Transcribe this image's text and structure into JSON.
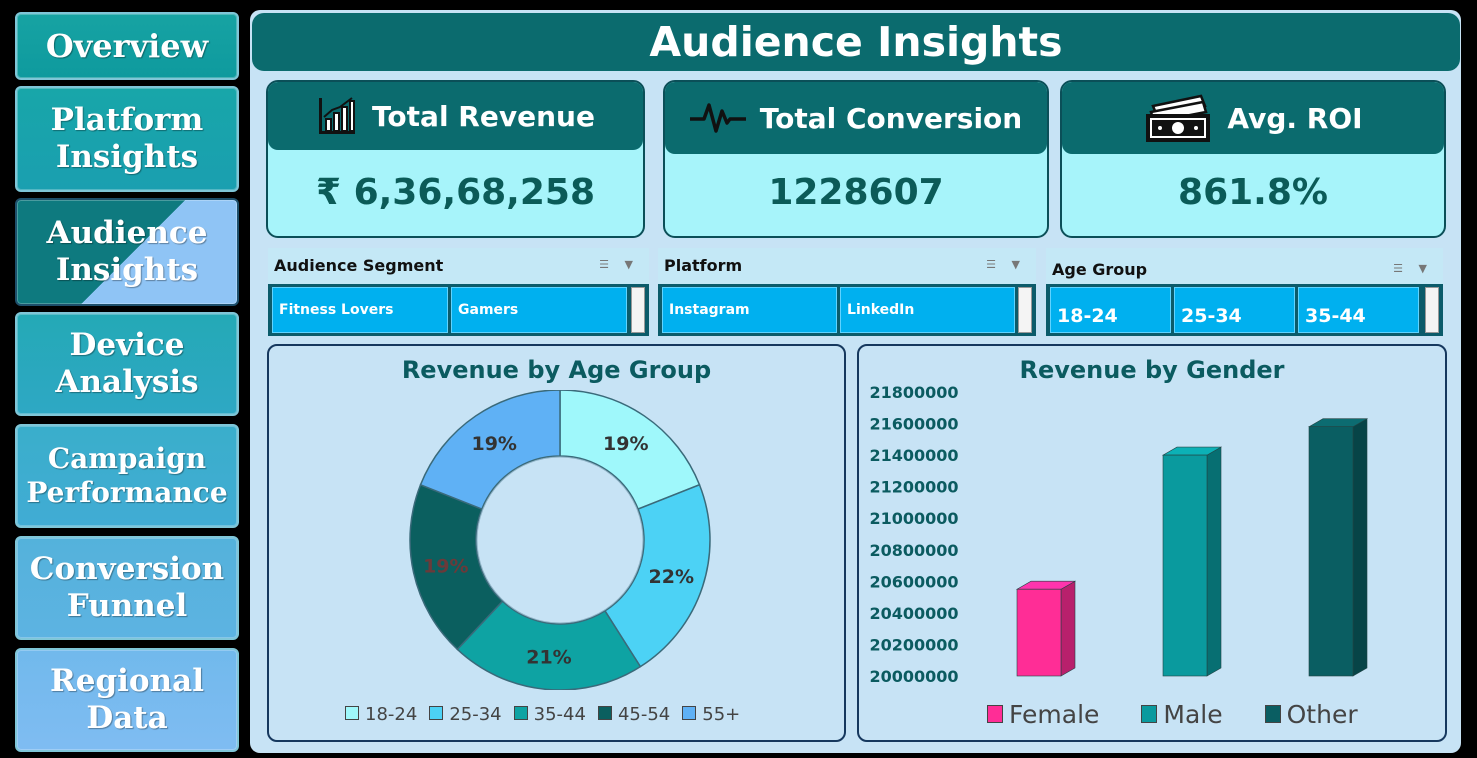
{
  "nav": [
    {
      "label": "Overview"
    },
    {
      "label": "Platform\nInsights"
    },
    {
      "label": "Audience\nInsights"
    },
    {
      "label": "Device\nAnalysis"
    },
    {
      "label": "Campaign\nPerformance"
    },
    {
      "label": "Conversion\nFunnel"
    },
    {
      "label": "Regional\nData"
    }
  ],
  "header": {
    "title": "Audience Insights"
  },
  "kpis": [
    {
      "label": "Total Revenue",
      "value": "₹ 6,36,68,258",
      "icon": "bar-chart-icon"
    },
    {
      "label": "Total Conversion",
      "value": "1228607",
      "icon": "pulse-icon"
    },
    {
      "label": "Avg. ROI",
      "value": "861.8%",
      "icon": "money-icon"
    }
  ],
  "slicers": [
    {
      "title": "Audience Segment",
      "items": [
        "Fitness Lovers",
        "Gamers"
      ]
    },
    {
      "title": "Platform",
      "items": [
        "Instagram",
        "LinkedIn"
      ]
    },
    {
      "title": "Age Group",
      "items": [
        "18-24",
        "25-34",
        "35-44"
      ]
    }
  ],
  "colors": {
    "teal_dark": "#0b6b6e",
    "kpi_bg": "#a7f4fa",
    "slicer_item": "#00b0ef",
    "female": "#ff2d96",
    "male": "#0a9a9e",
    "other": "#0a5e62"
  },
  "chart_data": [
    {
      "type": "pie",
      "title": "Revenue by Age Group",
      "categories": [
        "18-24",
        "25-34",
        "35-44",
        "45-54",
        "55+"
      ],
      "values": [
        19,
        22,
        21,
        19,
        19
      ],
      "labels": [
        "19%",
        "22%",
        "21%",
        "19%",
        "19%"
      ],
      "colors": [
        "#9ff8fb",
        "#4cd2f5",
        "#0ea3a3",
        "#0b5f5f",
        "#5fb1f5"
      ],
      "legend": "bottom"
    },
    {
      "type": "bar",
      "title": "Revenue by Gender",
      "categories": [
        "Female",
        "Male",
        "Other"
      ],
      "values": [
        20550000,
        21400000,
        21580000
      ],
      "ylim": [
        20000000,
        21800000
      ],
      "yticks": [
        "20000000",
        "20200000",
        "20400000",
        "20600000",
        "20800000",
        "21000000",
        "21200000",
        "21400000",
        "21600000",
        "21800000"
      ],
      "colors": [
        "#ff2d96",
        "#0a9a9e",
        "#0a5e62"
      ],
      "legend": "bottom"
    }
  ]
}
